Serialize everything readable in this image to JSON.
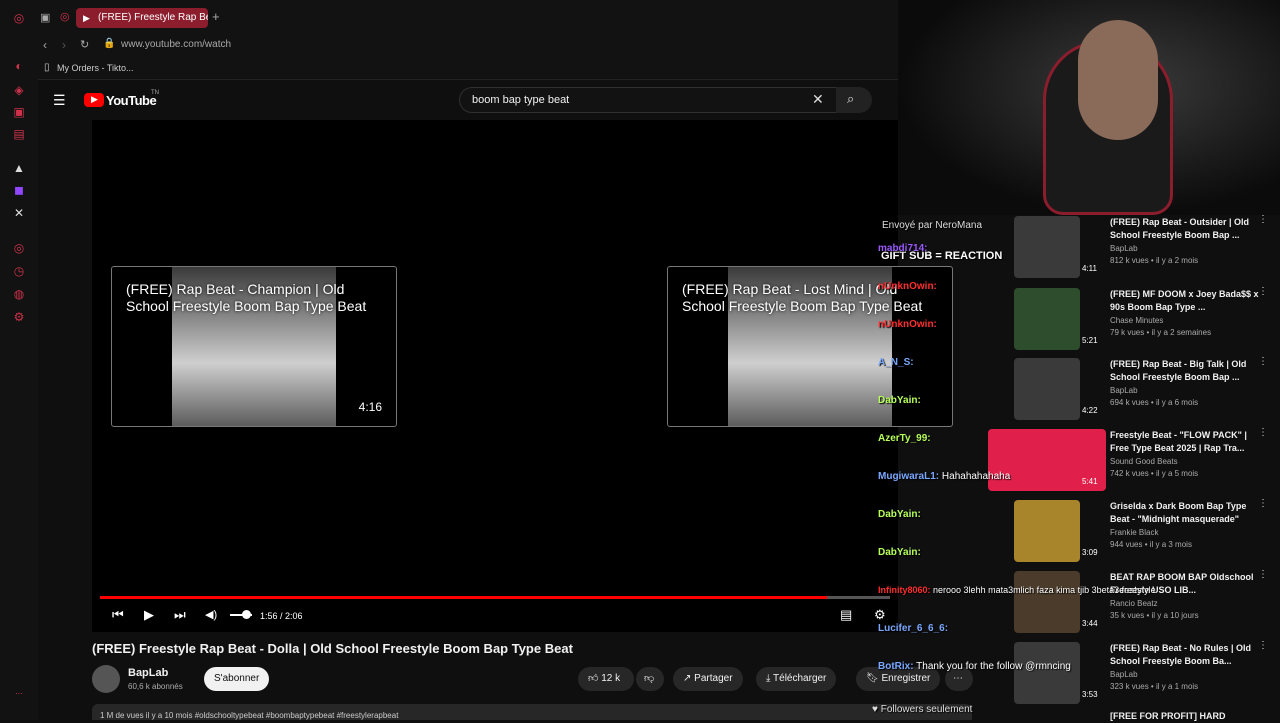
{
  "browser": {
    "tab_title": "(FREE) Freestyle Rap Beat",
    "url": "www.youtube.com/watch",
    "bookmark": "My Orders - Tikto..."
  },
  "youtube": {
    "logo": "YouTube",
    "search_value": "boom bap type beat"
  },
  "endcards": [
    {
      "title": "(FREE) Rap Beat - Champion | Old School Freestyle Boom Bap Type Beat",
      "duration": "4:16"
    },
    {
      "title": "(FREE) Rap Beat - Lost Mind | Old School Freestyle Boom Bap Type Beat",
      "duration": ""
    }
  ],
  "player": {
    "time": "1:56 / 2:06",
    "progress": 0.92
  },
  "video": {
    "title": "(FREE) Freestyle Rap Beat - Dolla | Old School Freestyle Boom Bap Type Beat",
    "channel": "BapLab",
    "subscribers": "60,6 k abonnés",
    "subscribe_label": "S'abonner",
    "likes": "12 k",
    "share_label": "Partager",
    "download_label": "Télécharger",
    "save_label": "Enregistrer",
    "description": "1 M de vues  il y a 10 mois  #oldschooltypebeat #boombaptypebeat #freestylerapbeat"
  },
  "recommendations": [
    {
      "title": "(FREE) Rap Beat - Outsider | Old School Freestyle Boom Bap ...",
      "channel": "BapLab",
      "meta": "812 k vues • il y a 2 mois",
      "duration": "4:11"
    },
    {
      "title": "(FREE) MF DOOM x Joey Bada$$ x 90s Boom Bap Type ...",
      "channel": "Chase Minutes",
      "meta": "79 k vues • il y a 2 semaines",
      "duration": "5:21"
    },
    {
      "title": "(FREE) Rap Beat - Big Talk | Old School Freestyle Boom Bap ...",
      "channel": "BapLab",
      "meta": "694 k vues • il y a 6 mois",
      "duration": "4:22"
    },
    {
      "title": "Freestyle Beat - \"FLOW PACK\" | Free Type Beat 2025 | Rap Tra...",
      "channel": "Sound Good Beats",
      "meta": "742 k vues • il y a 5 mois",
      "duration": "5:41"
    },
    {
      "title": "Griselda x Dark Boom Bap Type Beat - \"Midnight masquerade\"",
      "channel": "Frankie Black",
      "meta": "944 vues • il y a 3 mois",
      "duration": "3:09"
    },
    {
      "title": "BEAT RAP BOOM BAP Oldschool Freestyle USO LIB...",
      "channel": "Rancio Beatz",
      "meta": "35 k vues • il y a 10 jours",
      "duration": "3:44"
    },
    {
      "title": "(FREE) Rap Beat - No Rules | Old School Freestyle Boom Ba...",
      "channel": "BapLab",
      "meta": "323 k vues • il y a 1 mois",
      "duration": "3:53"
    },
    {
      "title": "[FREE FOR PROFIT] HARD",
      "channel": "",
      "meta": "",
      "duration": ""
    }
  ],
  "chat": {
    "alert_line": "Envoyé par NeroMana",
    "gift_sub": "GIFT SUB = REACTION",
    "messages": [
      {
        "user": "mabdi714:",
        "text": ""
      },
      {
        "user": "nUnknOwin:",
        "text": ""
      },
      {
        "user": "nUnknOwin:",
        "text": ""
      },
      {
        "user": "A_N_S:",
        "text": ""
      },
      {
        "user": "DabYain:",
        "text": ""
      },
      {
        "user": "AzerTy_99:",
        "text": ""
      },
      {
        "user": "MugiwaraL1:",
        "text": "Hahahahahaha"
      },
      {
        "user": "DabYain:",
        "text": ""
      },
      {
        "user": "DabYain:",
        "text": ""
      },
      {
        "user": "Infinity8060:",
        "text": "nerooo 3lehh mata3mlich faza kima tjib 3beta3 freestyle"
      },
      {
        "user": "Lucifer_6_6_6:",
        "text": ""
      },
      {
        "user": "BotRix:",
        "text": "Thank you for the follow @rmncing"
      }
    ],
    "footer": "Followers seulement"
  }
}
